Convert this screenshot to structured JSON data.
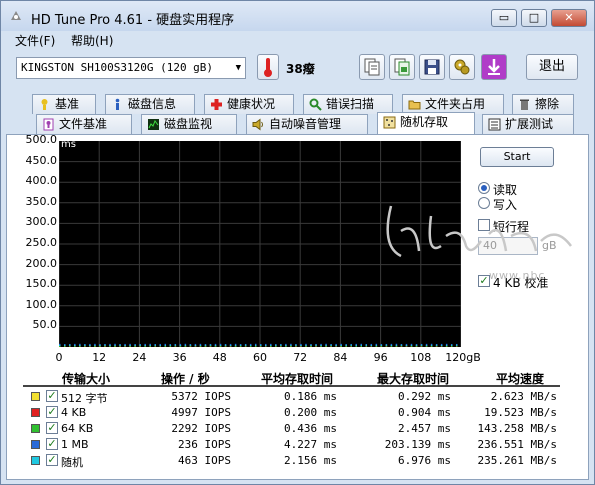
{
  "window": {
    "title": "HD Tune Pro 4.61 - 硬盘实用程序",
    "buttons": {
      "minimize": "▭",
      "maximize": "□",
      "close": "✕"
    }
  },
  "menu": [
    {
      "label": "文件(F)"
    },
    {
      "label": "帮助(H)"
    }
  ],
  "toolbar": {
    "drive": "KINGSTON SH100S3120G    (120 gB)",
    "temperature": "38癈",
    "exit_label": "退出",
    "icons": [
      "copy-icon",
      "copy-screen-icon",
      "save-icon",
      "settings-icon",
      "download-icon"
    ]
  },
  "tabs_row1": [
    {
      "label": "基准",
      "icon": "benchmark-icon"
    },
    {
      "label": "磁盘信息",
      "icon": "info-icon"
    },
    {
      "label": "健康状况",
      "icon": "health-icon"
    },
    {
      "label": "错误扫描",
      "icon": "error-scan-icon"
    },
    {
      "label": "文件夹占用",
      "icon": "folder-icon"
    },
    {
      "label": "擦除",
      "icon": "erase-icon"
    }
  ],
  "tabs_row2": [
    {
      "label": "文件基准",
      "icon": "file-benchmark-icon"
    },
    {
      "label": "磁盘监视",
      "icon": "monitor-icon"
    },
    {
      "label": "自动噪音管理",
      "icon": "speaker-icon"
    },
    {
      "label": "随机存取",
      "icon": "random-access-icon",
      "active": true
    },
    {
      "label": "扩展测试",
      "icon": "extra-test-icon"
    }
  ],
  "chart_data": {
    "type": "scatter",
    "ylabel": "ms",
    "xlabel": "gB",
    "ylim": [
      0,
      500
    ],
    "xlim": [
      0,
      120
    ],
    "y_ticks": [
      "500.0",
      "450.0",
      "400.0",
      "350.0",
      "300.0",
      "250.0",
      "200.0",
      "150.0",
      "100.0",
      "50.0"
    ],
    "x_ticks": [
      "0",
      "12",
      "24",
      "36",
      "48",
      "60",
      "72",
      "84",
      "96",
      "108",
      "120gB"
    ],
    "grid": true,
    "background": "#000000",
    "series": [
      {
        "name": "512 字节",
        "color": "#e8e020",
        "y_typical": 0.186
      },
      {
        "name": "4 KB",
        "color": "#e02020",
        "y_typical": 0.2
      },
      {
        "name": "64 KB",
        "color": "#20c020",
        "y_typical": 0.436
      },
      {
        "name": "1 MB",
        "color": "#2060e0",
        "y_typical": 4.227
      },
      {
        "name": "随机",
        "color": "#20c0e0",
        "y_typical": 2.156
      }
    ]
  },
  "controls": {
    "start_label": "Start",
    "read_label": "读取",
    "write_label": "写入",
    "short_stroke_label": "短行程",
    "short_stroke_value": "40",
    "short_stroke_unit": "gB",
    "align_label": "4 KB 校准"
  },
  "watermark": {
    "url": "www.nbc"
  },
  "table": {
    "headers": [
      "传输大小",
      "操作 / 秒",
      "平均存取时间",
      "最大存取时间",
      "平均速度"
    ],
    "rows": [
      {
        "size": "512 字节",
        "color": "#f2e030",
        "ops": "5372 IOPS",
        "avg": "0.186 ms",
        "max": "0.292 ms",
        "speed": "2.623 MB/s"
      },
      {
        "size": "4 KB",
        "color": "#e02020",
        "ops": "4997 IOPS",
        "avg": "0.200 ms",
        "max": "0.904 ms",
        "speed": "19.523 MB/s"
      },
      {
        "size": "64 KB",
        "color": "#30c030",
        "ops": "2292 IOPS",
        "avg": "0.436 ms",
        "max": "2.457 ms",
        "speed": "143.258 MB/s"
      },
      {
        "size": "1 MB",
        "color": "#2a6ad8",
        "ops": "236 IOPS",
        "avg": "4.227 ms",
        "max": "203.139 ms",
        "speed": "236.551 MB/s"
      },
      {
        "size": "随机",
        "color": "#20c8e0",
        "ops": "463 IOPS",
        "avg": "2.156 ms",
        "max": "6.976 ms",
        "speed": "235.261 MB/s"
      }
    ]
  }
}
